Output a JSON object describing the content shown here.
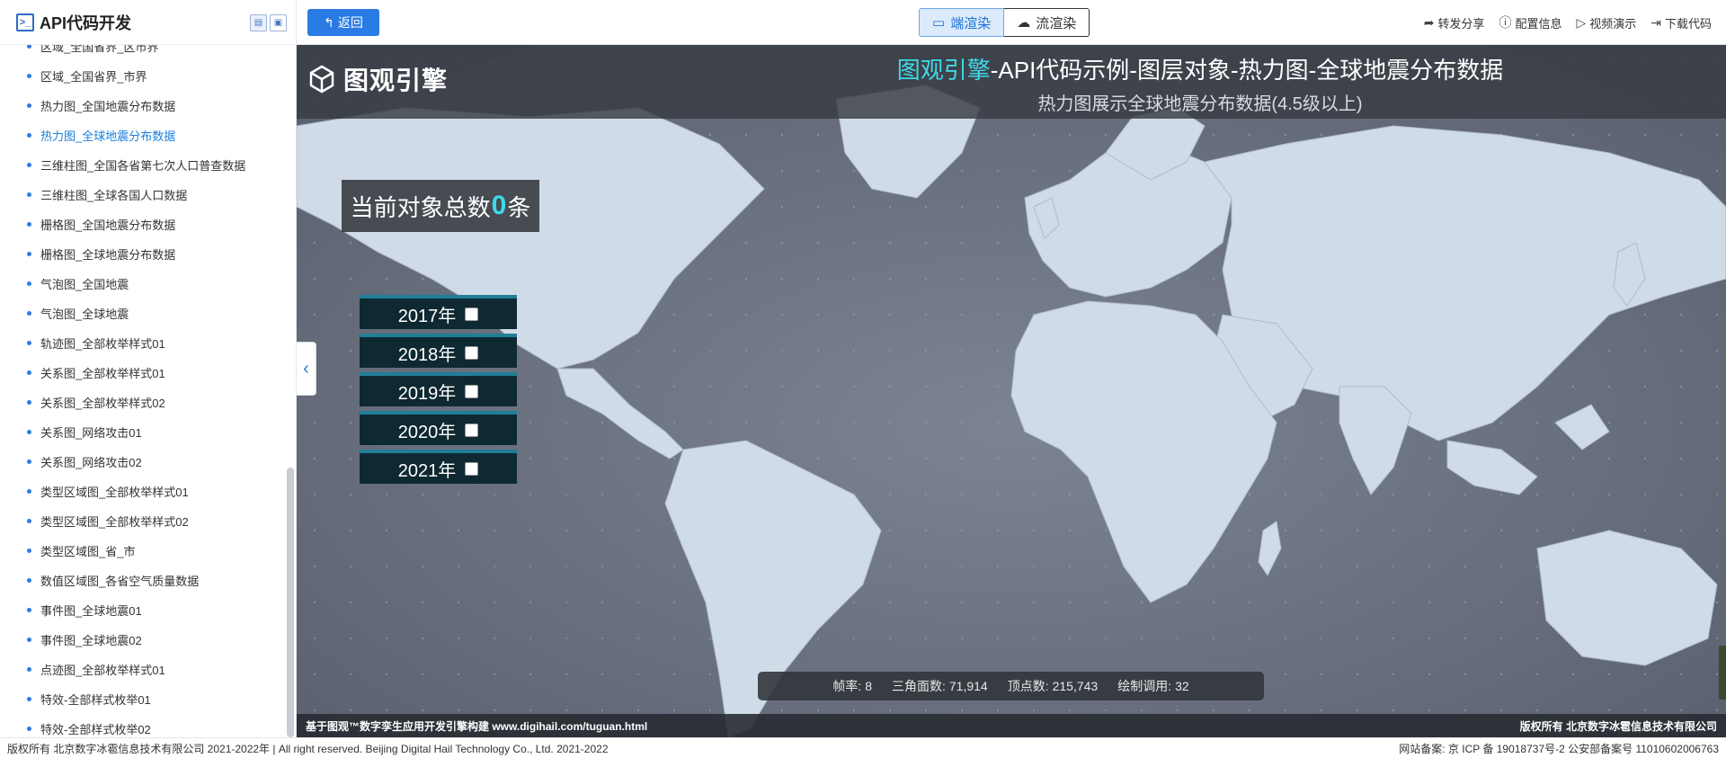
{
  "sidebar": {
    "title": "API代码开发",
    "items": [
      {
        "label": "区域_全国省界_区市界"
      },
      {
        "label": "区域_全国省界_市界"
      },
      {
        "label": "热力图_全国地震分布数据"
      },
      {
        "label": "热力图_全球地震分布数据",
        "active": true
      },
      {
        "label": "三维柱图_全国各省第七次人口普查数据"
      },
      {
        "label": "三维柱图_全球各国人口数据"
      },
      {
        "label": "栅格图_全国地震分布数据"
      },
      {
        "label": "栅格图_全球地震分布数据"
      },
      {
        "label": "气泡图_全国地震"
      },
      {
        "label": "气泡图_全球地震"
      },
      {
        "label": "轨迹图_全部枚举样式01"
      },
      {
        "label": "关系图_全部枚举样式01"
      },
      {
        "label": "关系图_全部枚举样式02"
      },
      {
        "label": "关系图_网络攻击01"
      },
      {
        "label": "关系图_网络攻击02"
      },
      {
        "label": "类型区域图_全部枚举样式01"
      },
      {
        "label": "类型区域图_全部枚举样式02"
      },
      {
        "label": "类型区域图_省_市"
      },
      {
        "label": "数值区域图_各省空气质量数据"
      },
      {
        "label": "事件图_全球地震01"
      },
      {
        "label": "事件图_全球地震02"
      },
      {
        "label": "点迹图_全部枚举样式01"
      },
      {
        "label": "特效-全部样式枚举01"
      },
      {
        "label": "特效-全部样式枚举02"
      }
    ]
  },
  "toolbar": {
    "back_label": "返回",
    "render_tabs": [
      "端渲染",
      "流渲染"
    ],
    "actions": [
      {
        "label": "转发分享",
        "icon": "share-icon"
      },
      {
        "label": "配置信息",
        "icon": "info-icon"
      },
      {
        "label": "视频演示",
        "icon": "play-icon"
      },
      {
        "label": "下载代码",
        "icon": "download-icon"
      }
    ]
  },
  "scene": {
    "logo_text": "图观引擎",
    "title_highlight": "图观引擎",
    "title_rest": "-API代码示例-图层对象-热力图-全球地震分布数据",
    "subtitle": "热力图展示全球地震分布数据(4.5级以上)",
    "count_prefix": "当前对象总数",
    "count_value": "0",
    "count_suffix": "条",
    "years": [
      {
        "label": "2017年"
      },
      {
        "label": "2018年"
      },
      {
        "label": "2019年"
      },
      {
        "label": "2020年"
      },
      {
        "label": "2021年"
      }
    ],
    "stats": {
      "fps_label": "帧率:",
      "fps": "8",
      "tri_label": "三角面数:",
      "tri": "71,914",
      "vert_label": "顶点数:",
      "vert": "215,743",
      "draw_label": "绘制调用:",
      "draw": "32"
    },
    "footer_left": "基于图观™数字孪生应用开发引擎构建 www.digihail.com/tuguan.html",
    "footer_right": "版权所有 北京数字冰雹信息技术有限公司"
  },
  "page_footer": {
    "left": "版权所有 北京数字冰雹信息技术有限公司 2021-2022年 | All right reserved. Beijing Digital Hail Technology Co., Ltd. 2021-2022",
    "right": "网站备案: 京 ICP 备 19018737号-2 公安部备案号 11010602006763"
  },
  "colors": {
    "accent": "#2a7be4",
    "highlight": "#3fd8e8",
    "ocean": "#6e7584",
    "land": "#cfdbe6"
  }
}
